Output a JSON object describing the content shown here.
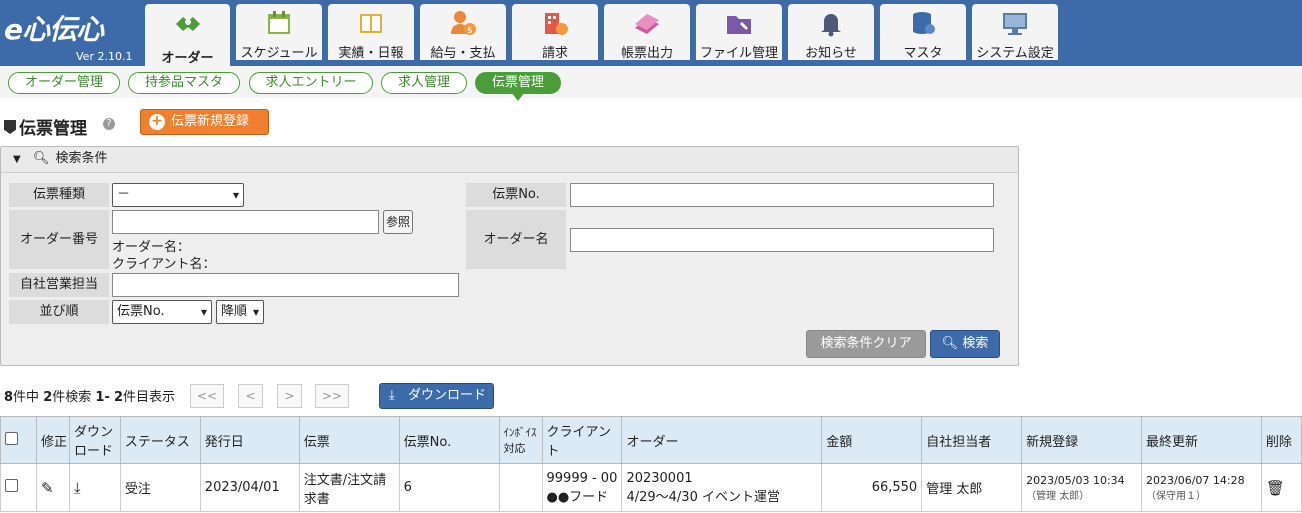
{
  "app": {
    "logo": "e心伝心",
    "version": "Ver 2.10.1"
  },
  "tabs": [
    {
      "label": "オーダー",
      "icon": "handshake-icon"
    },
    {
      "label": "スケジュール",
      "icon": "calendar-icon"
    },
    {
      "label": "実績・日報",
      "icon": "book-icon"
    },
    {
      "label": "給与・支払",
      "icon": "payment-user-icon"
    },
    {
      "label": "請求",
      "icon": "building-invoice-icon"
    },
    {
      "label": "帳票出力",
      "icon": "papers-icon"
    },
    {
      "label": "ファイル管理",
      "icon": "folder-edit-icon"
    },
    {
      "label": "お知らせ",
      "icon": "bell-icon"
    },
    {
      "label": "マスタ",
      "icon": "database-icon"
    },
    {
      "label": "システム設定",
      "icon": "monitor-settings-icon"
    }
  ],
  "subnav": [
    "オーダー管理",
    "持参品マスタ",
    "求人エントリー",
    "求人管理",
    "伝票管理"
  ],
  "page": {
    "title": "伝票管理",
    "new_button": "伝票新規登録"
  },
  "search": {
    "header": "検索条件",
    "labels": {
      "type": "伝票種類",
      "order_no": "オーダー番号",
      "sales": "自社営業担当",
      "sort": "並び順",
      "slip_no": "伝票No.",
      "order_name": "オーダー名"
    },
    "type_value": "－",
    "ref_button": "参照",
    "order_name_line": "オーダー名：",
    "client_name_line": "クライアント名：",
    "sort_value": "伝票No.",
    "order_value": "降順",
    "clear_button": "検索条件クリア",
    "search_button": "検索"
  },
  "pager": {
    "total": "8",
    "total_suffix": "件中",
    "hits": "2",
    "hits_suffix": "件検索",
    "range_a": "1",
    "range_b": "2",
    "range_suffix": "件目表示",
    "first": "<<",
    "prev": "<",
    "next": ">",
    "last": ">>",
    "download": "ダウンロード"
  },
  "table": {
    "headers": [
      "修正",
      "ダウンロード",
      "ステータス",
      "発行日",
      "伝票",
      "伝票No.",
      "ｲﾝﾎﾞｲｽ対応",
      "クライアント",
      "オーダー",
      "金額",
      "自社担当者",
      "新規登録",
      "最終更新",
      "削除"
    ],
    "rows": [
      {
        "status": "受注",
        "issued": "2023/04/01",
        "slip": "注文書/注文請求書",
        "slip_no": "6",
        "invoice": "",
        "client": "99999 - 00 ●●フード",
        "order_no": "20230001",
        "order_name": "4/29～4/30 イベント運営",
        "amount": "66,550",
        "staff": "管理 太郎",
        "created": "2023/05/03 10:34",
        "created_by": "（管理 太郎）",
        "updated": "2023/06/07 14:28",
        "updated_by": "（保守用１）"
      }
    ]
  }
}
